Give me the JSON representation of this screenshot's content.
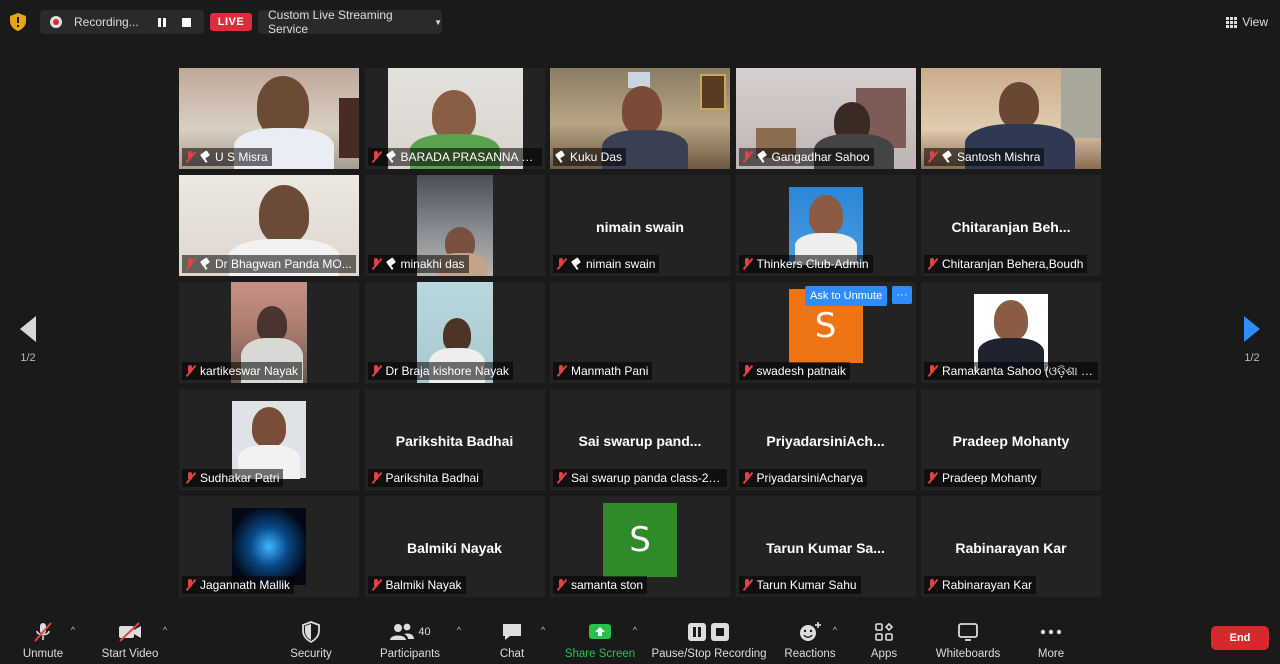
{
  "topbar": {
    "recording_label": "Recording...",
    "live_label": "LIVE",
    "stream_service": "Custom Live Streaming Service",
    "view_label": "View"
  },
  "navigation": {
    "left_page": "1/2",
    "right_page": "1/2"
  },
  "tiles": [
    {
      "label": "U S Misra",
      "center_name": "",
      "muted": true,
      "pinned": true,
      "kind": "video"
    },
    {
      "label": "BARADA PRASANNA DAS",
      "center_name": "",
      "muted": true,
      "pinned": true,
      "kind": "video"
    },
    {
      "label": "Kuku Das",
      "center_name": "",
      "muted": false,
      "pinned": true,
      "kind": "video",
      "active": true
    },
    {
      "label": "Gangadhar Sahoo",
      "center_name": "",
      "muted": true,
      "pinned": true,
      "kind": "video"
    },
    {
      "label": "Santosh Mishra",
      "center_name": "",
      "muted": true,
      "pinned": true,
      "kind": "video"
    },
    {
      "label": "Dr Bhagwan Panda MO...",
      "center_name": "",
      "muted": true,
      "pinned": true,
      "kind": "video"
    },
    {
      "label": "minakhi das",
      "center_name": "",
      "muted": true,
      "pinned": true,
      "kind": "video"
    },
    {
      "label": "nimain swain",
      "center_name": "nimain swain",
      "muted": true,
      "pinned": true,
      "kind": "name"
    },
    {
      "label": "Thinkers Club-Admin",
      "center_name": "",
      "muted": true,
      "pinned": false,
      "kind": "photo"
    },
    {
      "label": "Chitaranjan Behera,Boudh",
      "center_name": "Chitaranjan  Beh...",
      "muted": true,
      "pinned": false,
      "kind": "name"
    },
    {
      "label": "kartikeswar Nayak",
      "center_name": "",
      "muted": true,
      "pinned": false,
      "kind": "video"
    },
    {
      "label": "Dr Braja kishore Nayak",
      "center_name": "",
      "muted": true,
      "pinned": false,
      "kind": "video"
    },
    {
      "label": "Manmath Pani",
      "center_name": "",
      "muted": true,
      "pinned": false,
      "kind": "empty"
    },
    {
      "label": "swadesh patnaik",
      "center_name": "",
      "muted": true,
      "pinned": false,
      "kind": "avatar",
      "avatar_letter": "S",
      "avatar_color": "#ef7514"
    },
    {
      "label": "Ramakanta Sahoo (ଓଡ଼ିଶା ଲ...",
      "center_name": "",
      "muted": true,
      "pinned": false,
      "kind": "photo"
    },
    {
      "label": "Sudhakar Patri",
      "center_name": "",
      "muted": true,
      "pinned": false,
      "kind": "photo"
    },
    {
      "label": "Parikshita Badhai",
      "center_name": "Parikshita Badhai",
      "muted": true,
      "pinned": false,
      "kind": "name"
    },
    {
      "label": "Sai swarup panda class-2 r...",
      "center_name": "Sai swarup pand...",
      "muted": true,
      "pinned": false,
      "kind": "name"
    },
    {
      "label": "PriyadarsiniAcharya",
      "center_name": "PriyadarsiniAch...",
      "muted": true,
      "pinned": false,
      "kind": "name"
    },
    {
      "label": "Pradeep Mohanty",
      "center_name": "Pradeep Mohanty",
      "muted": true,
      "pinned": false,
      "kind": "name"
    },
    {
      "label": "Jagannath Mallik",
      "center_name": "",
      "muted": true,
      "pinned": false,
      "kind": "photo"
    },
    {
      "label": "Balmiki Nayak",
      "center_name": "Balmiki Nayak",
      "muted": true,
      "pinned": false,
      "kind": "name"
    },
    {
      "label": "samanta ston",
      "center_name": "",
      "muted": true,
      "pinned": false,
      "kind": "avatar",
      "avatar_letter": "S",
      "avatar_color": "#2f8a2a"
    },
    {
      "label": "Tarun Kumar Sahu",
      "center_name": "Tarun Kumar Sa...",
      "muted": true,
      "pinned": false,
      "kind": "name"
    },
    {
      "label": "Rabinarayan Kar",
      "center_name": "Rabinarayan Kar",
      "muted": true,
      "pinned": false,
      "kind": "name"
    }
  ],
  "popover": {
    "ask_unmute": "Ask to Unmute",
    "more": "···"
  },
  "toolbar": {
    "unmute": "Unmute",
    "start_video": "Start Video",
    "security": "Security",
    "participants": "Participants",
    "participants_count": "40",
    "chat": "Chat",
    "share_screen": "Share Screen",
    "pause_stop_recording": "Pause/Stop Recording",
    "reactions": "Reactions",
    "apps": "Apps",
    "whiteboards": "Whiteboards",
    "more": "More",
    "end": "End"
  },
  "colors": {
    "background": "#1a1a1a",
    "tile": "#232323",
    "accent_blue": "#2d8cff",
    "active_speaker": "#c8e15b",
    "live_red": "#e02b3b",
    "end_red": "#d9272e",
    "share_green": "#27c24c",
    "muted_red": "#e04343"
  }
}
